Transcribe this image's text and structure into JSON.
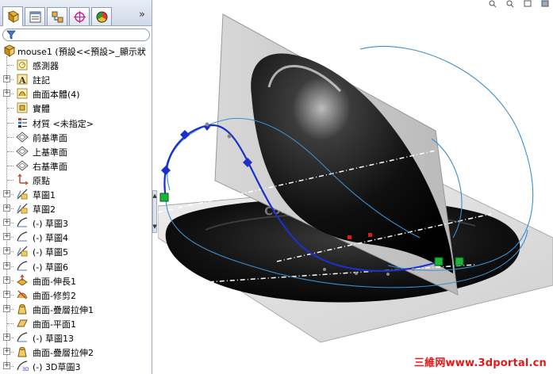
{
  "tabs": [
    {
      "name": "featuremanager-tab",
      "icon": "feature-tree-icon"
    },
    {
      "name": "propertymanager-tab",
      "icon": "property-sheet-icon"
    },
    {
      "name": "configurationmanager-tab",
      "icon": "configuration-icon"
    },
    {
      "name": "dimxpert-tab",
      "icon": "crosshair-target-icon"
    },
    {
      "name": "display-manager-tab",
      "icon": "color-wheel-icon"
    }
  ],
  "tab_more": "»",
  "filter": {
    "placeholder": "",
    "icon": "filter-funnel-icon"
  },
  "tree": {
    "root": {
      "label": "mouse1  (預設<<預設>_顯示狀",
      "icon": "part-icon"
    },
    "items": [
      {
        "label": "感測器",
        "icon": "sensor-icon",
        "expandable": false
      },
      {
        "label": "註記",
        "icon": "annotation-icon",
        "expandable": true
      },
      {
        "label": "曲面本體(4)",
        "icon": "surface-bodies-icon",
        "expandable": true
      },
      {
        "label": "實體",
        "icon": "solid-bodies-icon",
        "expandable": false
      },
      {
        "label": "材質 <未指定>",
        "icon": "material-icon",
        "expandable": false
      },
      {
        "label": "前基準面",
        "icon": "plane-icon",
        "expandable": false
      },
      {
        "label": "上基準面",
        "icon": "plane-icon",
        "expandable": false
      },
      {
        "label": "右基準面",
        "icon": "plane-icon",
        "expandable": false
      },
      {
        "label": "原點",
        "icon": "origin-icon",
        "expandable": false
      },
      {
        "label": "草圖1",
        "icon": "sketch-picture-icon",
        "expandable": true
      },
      {
        "label": "草圖2",
        "icon": "sketch-picture-icon",
        "expandable": true
      },
      {
        "label": "(-) 草圖3",
        "icon": "sketch-icon",
        "expandable": true
      },
      {
        "label": "(-) 草圖4",
        "icon": "sketch-icon",
        "expandable": true
      },
      {
        "label": "(-) 草圖5",
        "icon": "sketch-picture-icon",
        "expandable": true
      },
      {
        "label": "(-) 草圖6",
        "icon": "sketch-icon",
        "expandable": true
      },
      {
        "label": "曲面-伸長1",
        "icon": "surface-extrude-icon",
        "expandable": true
      },
      {
        "label": "曲面-修剪2",
        "icon": "surface-trim-icon",
        "expandable": true
      },
      {
        "label": "曲面-疊層拉伸1",
        "icon": "surface-loft-icon",
        "expandable": true
      },
      {
        "label": "曲面-平面1",
        "icon": "planar-surface-icon",
        "expandable": false
      },
      {
        "label": "(-) 草圖13",
        "icon": "sketch-icon",
        "expandable": true
      },
      {
        "label": "曲面-疊層拉伸2",
        "icon": "surface-loft-icon",
        "expandable": true
      },
      {
        "label": "(-) 3D草圖3",
        "icon": "sketch-3d-icon",
        "expandable": true
      }
    ]
  },
  "viewport": {
    "watermark": "三維网www.3dportal.cn",
    "model_logo_text": "Cordless"
  },
  "colors": {
    "panel_border": "#9aa7b8",
    "sketch_blue": "#1c2fc8",
    "curve_cyan": "#3a8fd0",
    "endpoint_green": "#1bb53a",
    "watermark_red": "#e01a1a"
  }
}
